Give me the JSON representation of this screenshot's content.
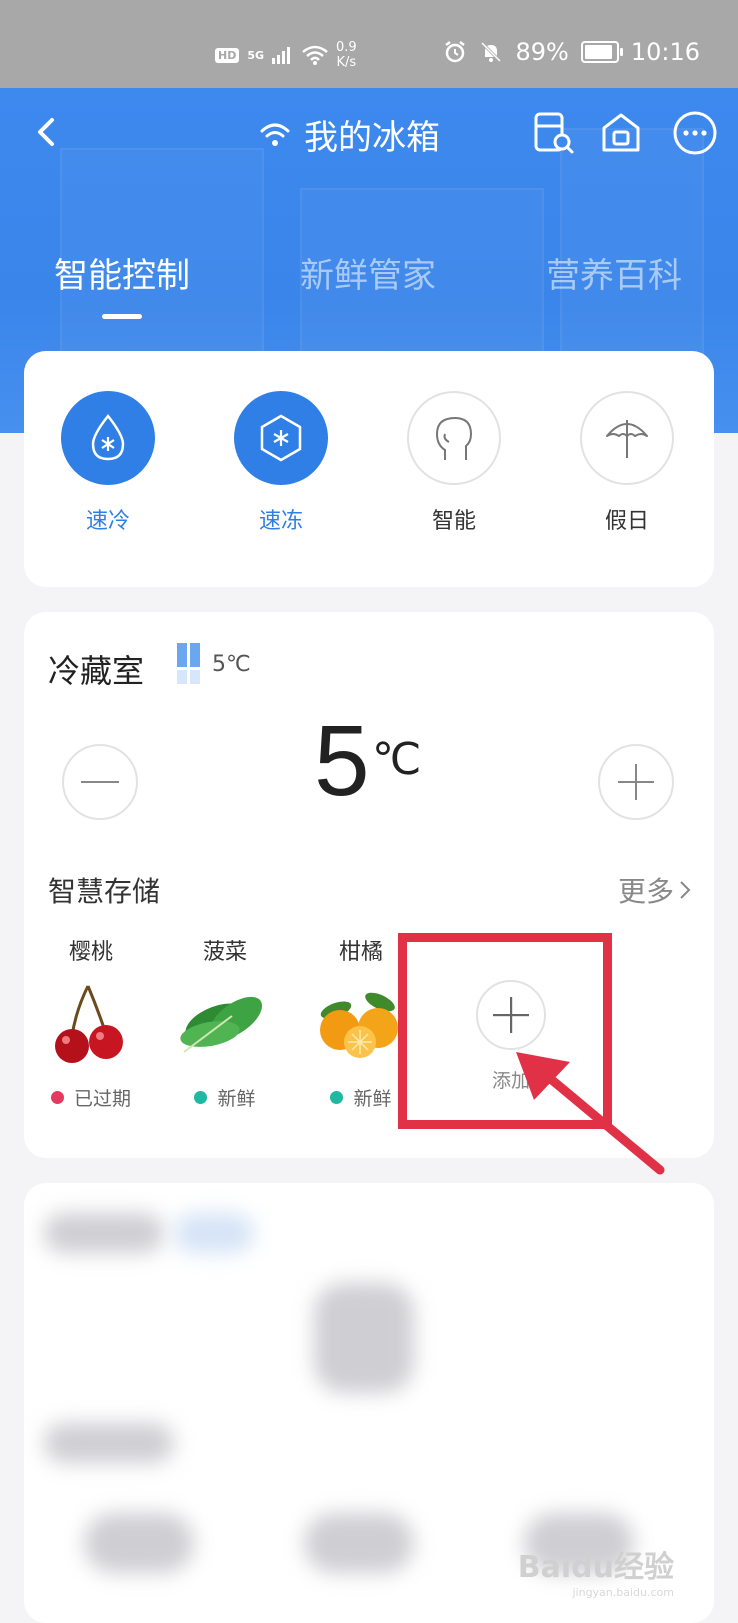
{
  "status_bar": {
    "hd": "HD",
    "network": "5G",
    "speed_value": "0.9",
    "speed_unit": "K/s",
    "battery": "89%",
    "battery_level": 0.89,
    "time": "10:16"
  },
  "header": {
    "title": "我的冰箱",
    "icons": [
      "back-arrow-icon",
      "wifi-icon",
      "fridge-search-icon",
      "home-icon",
      "more-icon"
    ]
  },
  "tabs": [
    {
      "label": "智能控制",
      "active": true
    },
    {
      "label": "新鲜管家",
      "active": false
    },
    {
      "label": "营养百科",
      "active": false
    }
  ],
  "modes": [
    {
      "label": "速冷",
      "active": true,
      "icon": "drop-snowflake-icon"
    },
    {
      "label": "速冻",
      "active": true,
      "icon": "hexagon-snowflake-icon"
    },
    {
      "label": "智能",
      "active": false,
      "icon": "head-icon"
    },
    {
      "label": "假日",
      "active": false,
      "icon": "umbrella-icon"
    }
  ],
  "compartment": {
    "name": "冷藏室",
    "small_temp": "5℃",
    "temp_value": "5",
    "temp_unit": "℃"
  },
  "storage": {
    "title": "智慧存储",
    "more": "更多",
    "items": [
      {
        "name": "樱桃",
        "status": "已过期",
        "status_color": "#e53a5f",
        "image": "cherry-image"
      },
      {
        "name": "菠菜",
        "status": "新鲜",
        "status_color": "#1fb8a0",
        "image": "spinach-image"
      },
      {
        "name": "柑橘",
        "status": "新鲜",
        "status_color": "#1fb8a0",
        "image": "orange-image"
      }
    ],
    "add_label": "添加"
  },
  "colors": {
    "primary": "#2f7fe6",
    "highlight": "#e03146"
  },
  "watermark": {
    "brand": "Baidu经验",
    "url": "jingyan.baidu.com"
  }
}
